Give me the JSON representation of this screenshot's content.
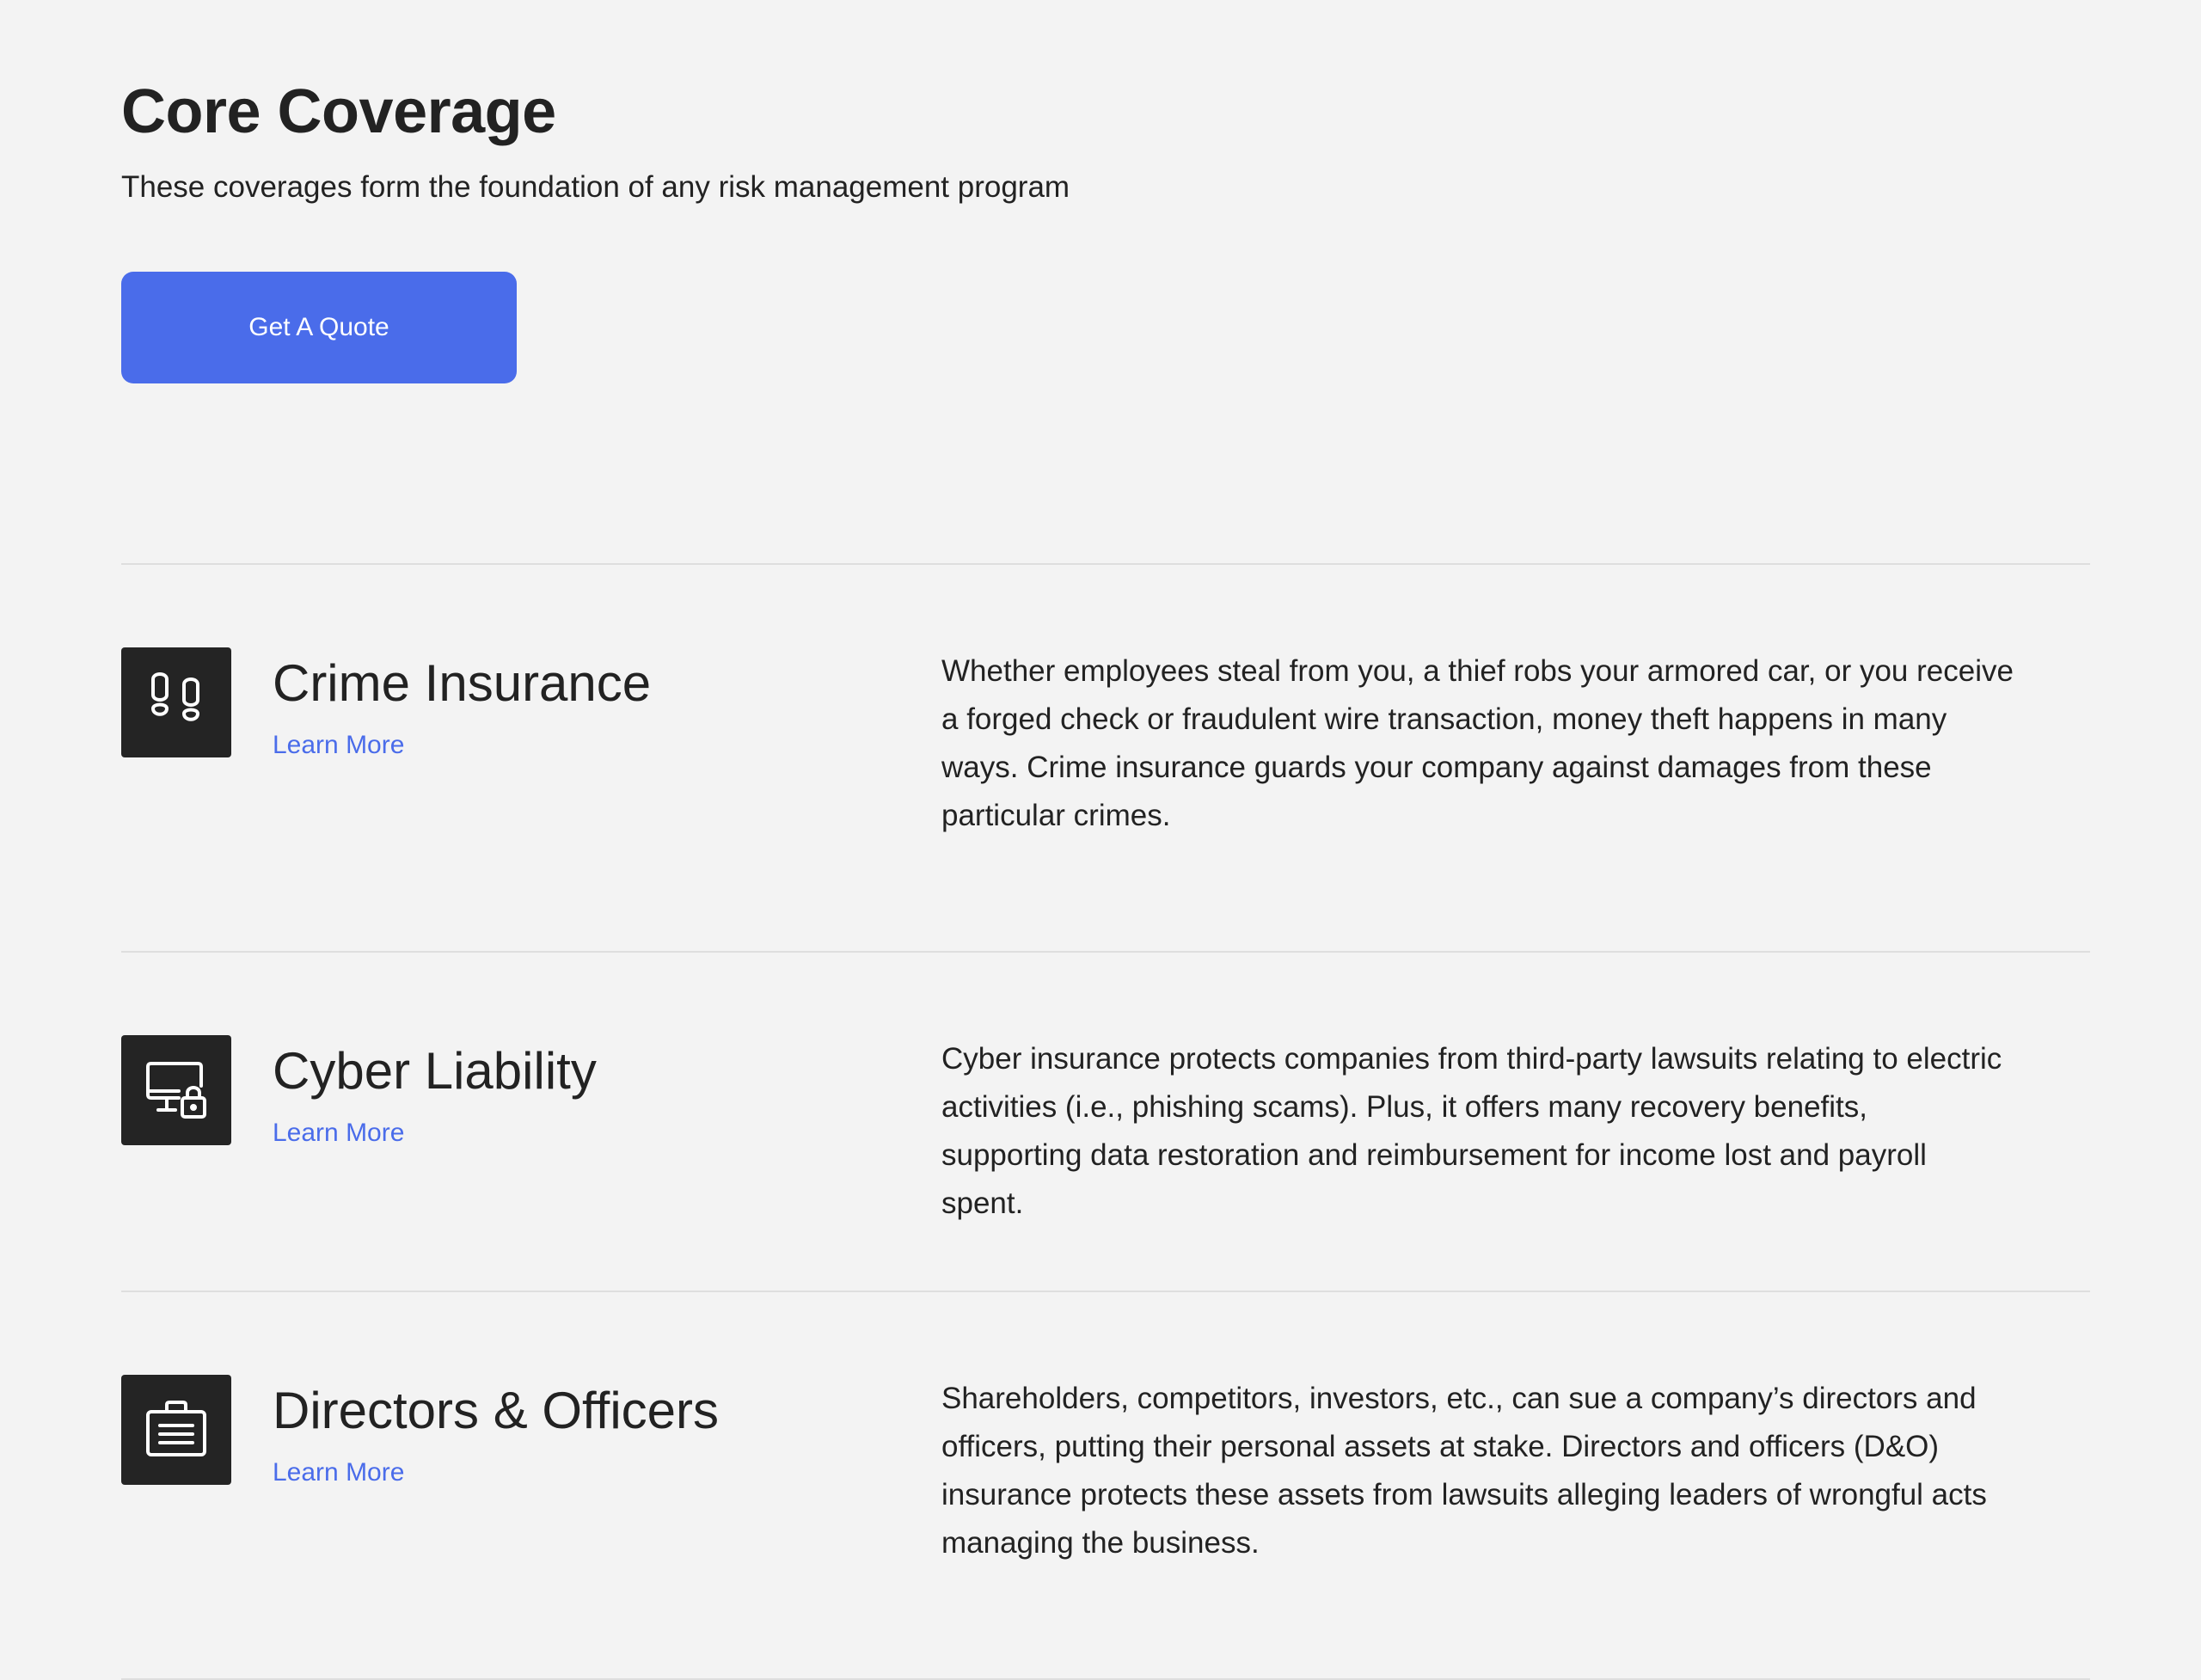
{
  "header": {
    "title": "Core Coverage",
    "subtitle": "These coverages form the foundation of any risk management program",
    "cta_label": "Get A Quote"
  },
  "colors": {
    "accent": "#4a6cea",
    "icon_tile": "#242424",
    "background": "#f3f3f3",
    "divider": "#dedede",
    "text": "#222222"
  },
  "coverages": [
    {
      "icon": "footprints-icon",
      "title": "Crime Insurance",
      "link_label": "Learn More",
      "description": "Whether employees steal from you, a thief robs your armored car, or you receive a forged check or fraudulent wire transaction, money theft happens in many ways. Crime insurance guards your company against damages from these particular crimes."
    },
    {
      "icon": "computer-lock-icon",
      "title": "Cyber Liability",
      "link_label": "Learn More",
      "description": "Cyber insurance protects companies from third-party lawsuits relating to electric activities (i.e., phishing scams). Plus, it offers many recovery benefits, supporting data restoration and reimbursement for income lost and payroll spent."
    },
    {
      "icon": "briefcase-icon",
      "title": "Directors & Officers",
      "link_label": "Learn More",
      "description": "Shareholders, competitors, investors, etc., can sue a company’s directors and officers, putting their personal assets at stake. Directors and officers (D&O) insurance protects these assets from lawsuits alleging leaders of wrongful acts managing the business."
    }
  ]
}
